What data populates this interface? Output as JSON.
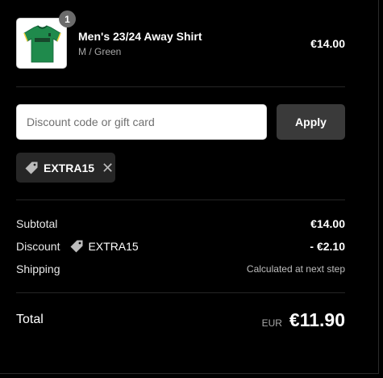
{
  "product": {
    "quantity": "1",
    "name": "Men's 23/24 Away Shirt",
    "variant": "M / Green",
    "price": "€14.00",
    "image_icon": "green-jersey-image"
  },
  "discount": {
    "placeholder": "Discount code or gift card",
    "value": "",
    "apply_label": "Apply",
    "applied_code": "EXTRA15",
    "remove_icon": "close-icon"
  },
  "summary": {
    "subtotal_label": "Subtotal",
    "subtotal_value": "€14.00",
    "discount_label": "Discount",
    "discount_code": "EXTRA15",
    "discount_value": "- €2.10",
    "shipping_label": "Shipping",
    "shipping_value": "Calculated at next step",
    "total_label": "Total",
    "currency": "EUR",
    "total_value": "€11.90"
  },
  "colors": {
    "background": "#000000",
    "jersey": "#1f8a4c",
    "button": "#3a3a3a",
    "chip": "#262626"
  }
}
